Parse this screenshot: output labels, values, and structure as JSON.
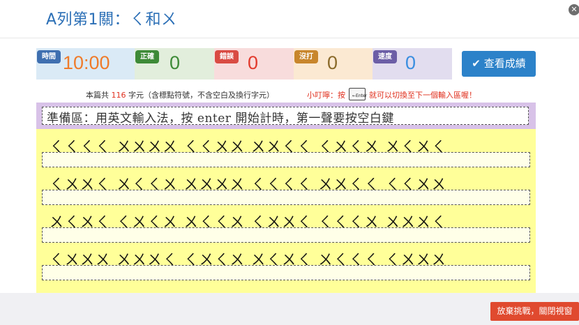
{
  "title": "A列第1關：ㄑ和ㄨ",
  "stats": [
    {
      "label": "時間",
      "value": "10:00",
      "bg": "#daeaf6",
      "badge": "#3f6fb0",
      "color": "#ef7b2a"
    },
    {
      "label": "正確",
      "value": "0",
      "bg": "#e2eedc",
      "badge": "#3d8a37",
      "color": "#3d8a37"
    },
    {
      "label": "錯誤",
      "value": "0",
      "bg": "#f8dcdc",
      "badge": "#d94b43",
      "color": "#e23b2e"
    },
    {
      "label": "沒打",
      "value": "0",
      "bg": "#fbe9d2",
      "badge": "#c8862c",
      "color": "#8a6a2a"
    },
    {
      "label": "速度",
      "value": "0",
      "bg": "#e2ddef",
      "badge": "#6c5ea6",
      "color": "#3a8ee0"
    }
  ],
  "result_button": "查看成績",
  "info": {
    "prefix": "本篇共",
    "count": "116",
    "suffix": "字元（含標點符號，不含空白及換行字元）"
  },
  "tip": {
    "before": "小叮嚀：按",
    "key": "←Enter",
    "after": "就可以切換至下一個輸入區喔！"
  },
  "prep": "準備區：用英文輸入法，按 enter 開始計時，第一聲要按空白鍵",
  "lines": [
    "ㄑㄑㄑㄑ ㄨㄨㄨㄨ ㄑㄑㄨㄨ ㄨㄨㄑㄑ ㄑㄨㄑㄨ ㄨㄑㄨㄑ",
    "ㄑㄨㄨㄑ ㄨㄑㄑㄨ ㄨㄨㄨㄨ ㄑㄑㄑㄑ ㄨㄨㄑㄑ ㄑㄑㄨㄨ",
    "ㄨㄑㄨㄑ ㄑㄨㄑㄨ ㄨㄑㄑㄨ ㄑㄨㄨㄑ ㄑㄑㄑㄨ ㄨㄨㄨㄑ",
    "ㄑㄨㄨㄨ ㄨㄨㄨㄑ ㄑㄨㄑㄨ ㄨㄑㄨㄑ ㄨㄑㄑㄑ ㄑㄨㄨㄨ"
  ],
  "quit_button": "放棄挑戰，關閉視窗"
}
